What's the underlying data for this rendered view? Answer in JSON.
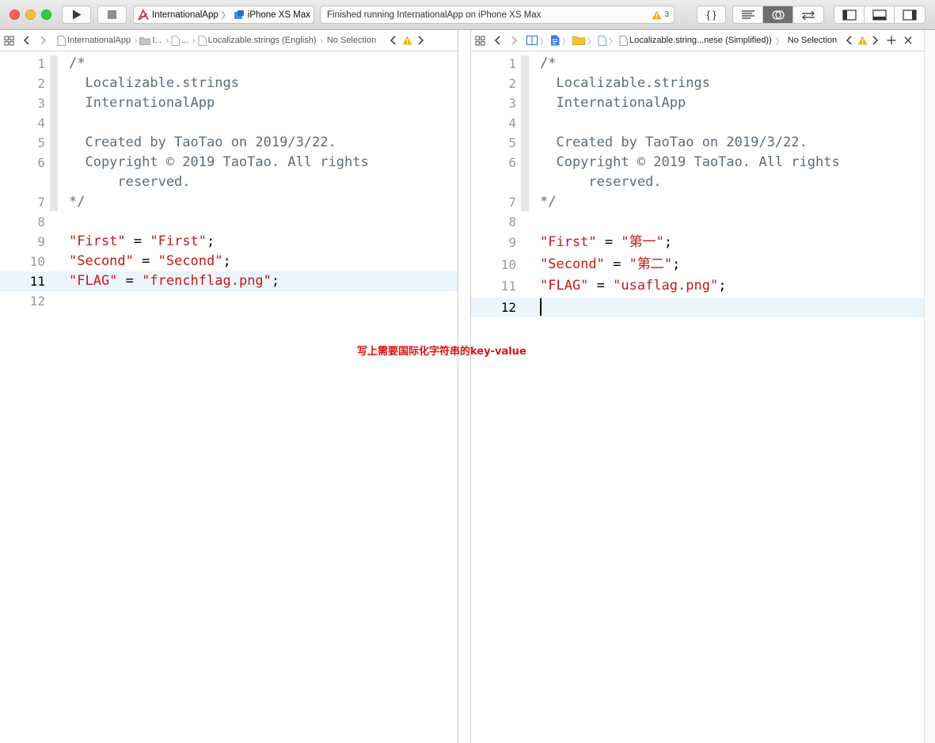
{
  "toolbar": {
    "scheme_app": "InternationalApp",
    "scheme_device": "iPhone XS Max",
    "status_text": "Finished running InternationalApp on iPhone XS Max",
    "warning_count": "3",
    "code_review_label": "{ }"
  },
  "left_editor": {
    "jumpbar": {
      "project": "InternationalApp",
      "group": "I...",
      "folder": "...",
      "file": "Localizable.strings (English)",
      "selection": "No Selection"
    },
    "lines": [
      {
        "num": "1",
        "text": "/*",
        "kind": "comment"
      },
      {
        "num": "2",
        "text": "  Localizable.strings",
        "kind": "comment"
      },
      {
        "num": "3",
        "text": "  InternationalApp",
        "kind": "comment"
      },
      {
        "num": "4",
        "text": "",
        "kind": "comment"
      },
      {
        "num": "5",
        "text": "  Created by TaoTao on 2019/3/22.",
        "kind": "comment"
      },
      {
        "num": "6",
        "text": "  Copyright © 2019 TaoTao. All rights",
        "kind": "comment"
      },
      {
        "num": "",
        "text": "      reserved.",
        "kind": "comment"
      },
      {
        "num": "7",
        "text": "*/",
        "kind": "comment"
      },
      {
        "num": "8",
        "text": "",
        "kind": "comment"
      },
      {
        "num": "9",
        "key": "\"First\"",
        "eq": " = ",
        "value": "\"First\"",
        "end": ";"
      },
      {
        "num": "10",
        "key": "\"Second\"",
        "eq": " = ",
        "value": "\"Second\"",
        "end": ";"
      },
      {
        "num": "11",
        "key": "\"FLAG\"",
        "eq": " = ",
        "value": "\"frenchflag.png\"",
        "end": ";"
      },
      {
        "num": "12",
        "text": "",
        "kind": "comment"
      }
    ]
  },
  "right_editor": {
    "jumpbar": {
      "file": "Localizable.string...nese (Simplified))",
      "selection": "No Selection"
    },
    "lines": [
      {
        "num": "1",
        "text": "/*",
        "kind": "comment"
      },
      {
        "num": "2",
        "text": "  Localizable.strings",
        "kind": "comment"
      },
      {
        "num": "3",
        "text": "  InternationalApp",
        "kind": "comment"
      },
      {
        "num": "4",
        "text": "",
        "kind": "comment"
      },
      {
        "num": "5",
        "text": "  Created by TaoTao on 2019/3/22.",
        "kind": "comment"
      },
      {
        "num": "6",
        "text": "  Copyright © 2019 TaoTao. All rights",
        "kind": "comment"
      },
      {
        "num": "",
        "text": "      reserved.",
        "kind": "comment"
      },
      {
        "num": "7",
        "text": "*/",
        "kind": "comment"
      },
      {
        "num": "8",
        "text": "",
        "kind": "comment"
      },
      {
        "num": "9",
        "key": "\"First\"",
        "eq": " = ",
        "value": "\"第一\"",
        "end": ";"
      },
      {
        "num": "10",
        "key": "\"Second\"",
        "eq": " = ",
        "value": "\"第二\"",
        "end": ";"
      },
      {
        "num": "11",
        "key": "\"FLAG\"",
        "eq": " = ",
        "value": "\"usaflag.png\"",
        "end": ";"
      },
      {
        "num": "12",
        "text": "",
        "kind": "comment"
      }
    ]
  },
  "annotation": "写上需要国际化字符串的key-value",
  "colors": {
    "string": "#c41a16",
    "comment": "#5d6c79",
    "current_line": "#ecf5fe",
    "annotation": "#e01010"
  }
}
